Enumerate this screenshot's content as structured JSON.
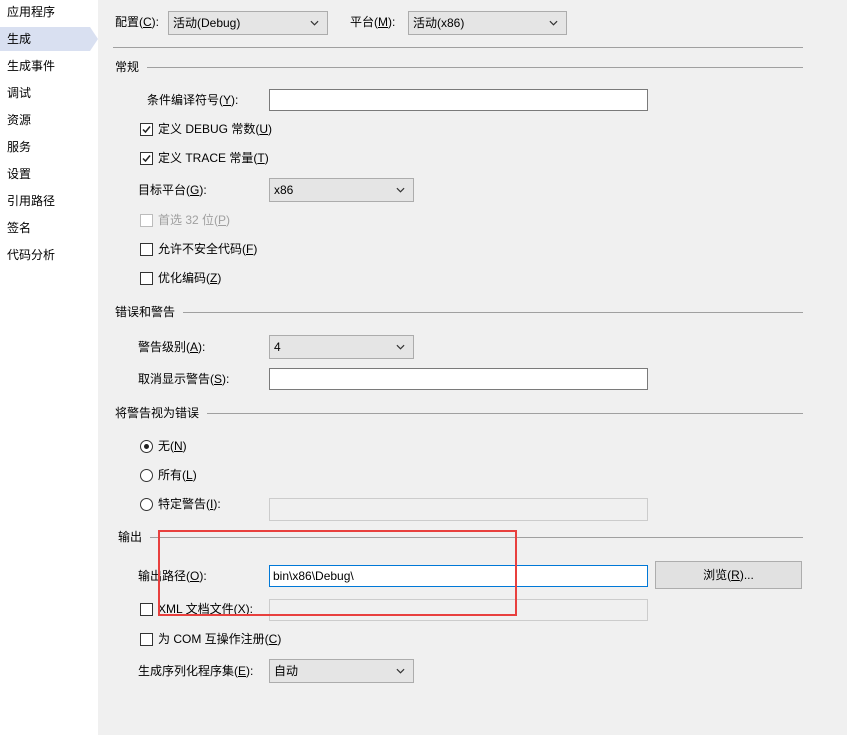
{
  "sidebar": {
    "items": [
      "应用程序",
      "生成",
      "生成事件",
      "调试",
      "资源",
      "服务",
      "设置",
      "引用路径",
      "签名",
      "代码分析"
    ],
    "selected_index": 1
  },
  "toolbar": {
    "configuration": {
      "label": "配置(C):",
      "value": "活动(Debug)"
    },
    "platform": {
      "label": "平台(M):",
      "value": "活动(x86)"
    }
  },
  "general": {
    "title": "常规",
    "conditional_symbols": {
      "label": "条件编译符号(Y):",
      "value": ""
    },
    "define_debug": {
      "label": "定义 DEBUG 常数(U)",
      "checked": true
    },
    "define_trace": {
      "label": "定义 TRACE 常量(T)",
      "checked": true
    },
    "platform_target": {
      "label": "目标平台(G):",
      "value": "x86"
    },
    "prefer_32bit": {
      "label": "首选 32 位(P)",
      "checked": false,
      "disabled": true
    },
    "allow_unsafe": {
      "label": "允许不安全代码(F)",
      "checked": false
    },
    "optimize": {
      "label": "优化编码(Z)",
      "checked": false
    }
  },
  "errors": {
    "title": "错误和警告",
    "warning_level": {
      "label": "警告级别(A):",
      "value": "4"
    },
    "suppress_warnings": {
      "label": "取消显示警告(S):",
      "value": ""
    }
  },
  "treat_as_errors": {
    "title": "将警告视为错误",
    "options": [
      {
        "label": "无(N)",
        "selected": true
      },
      {
        "label": "所有(L)",
        "selected": false
      },
      {
        "label": "特定警告(I):",
        "selected": false
      }
    ],
    "specific_value": ""
  },
  "output": {
    "title": "输出",
    "path": {
      "label": "输出路径(O):",
      "value": "bin\\x86\\Debug\\"
    },
    "browse_label": "浏览(R)...",
    "xml_doc": {
      "label": "XML 文档文件(X):",
      "checked": false,
      "value": ""
    },
    "com_interop": {
      "label": "为 COM 互操作注册(C)",
      "checked": false
    },
    "serialization": {
      "label": "生成序列化程序集(E):",
      "value": "自动"
    }
  },
  "colors": {
    "accent": "#0078d7",
    "annotation": "#e8403e",
    "sidebar_selected": "#d9e0f1"
  }
}
